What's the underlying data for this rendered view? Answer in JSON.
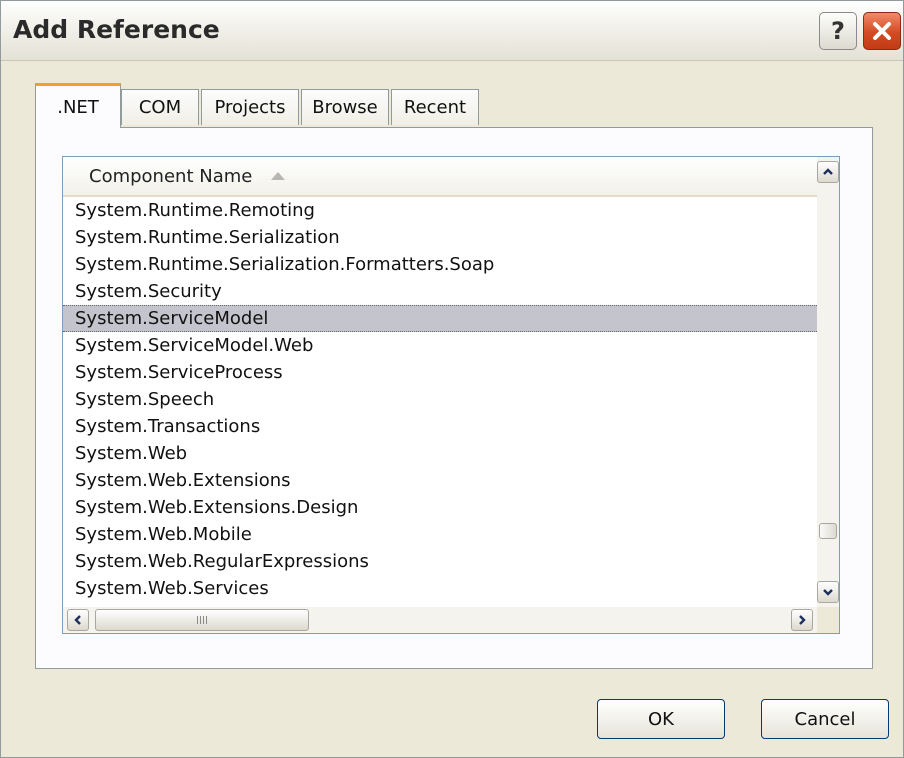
{
  "window": {
    "title": "Add Reference",
    "help_label": "?"
  },
  "tabs": [
    {
      "label": ".NET",
      "active": true
    },
    {
      "label": "COM",
      "active": false
    },
    {
      "label": "Projects",
      "active": false
    },
    {
      "label": "Browse",
      "active": false
    },
    {
      "label": "Recent",
      "active": false
    }
  ],
  "list": {
    "column_header": "Component Name",
    "sort": "ascending",
    "selected_item": "System.ServiceModel",
    "items": [
      "System.Runtime.Remoting",
      "System.Runtime.Serialization",
      "System.Runtime.Serialization.Formatters.Soap",
      "System.Security",
      "System.ServiceModel",
      "System.ServiceModel.Web",
      "System.ServiceProcess",
      "System.Speech",
      "System.Transactions",
      "System.Web",
      "System.Web.Extensions",
      "System.Web.Extensions.Design",
      "System.Web.Mobile",
      "System.Web.RegularExpressions",
      "System.Web.Services"
    ]
  },
  "buttons": {
    "ok": "OK",
    "cancel": "Cancel"
  },
  "colors": {
    "dialog_bg": "#ece9d8",
    "selection_bg": "#c4c4cc",
    "active_tab_accent": "#f3a028",
    "close_button": "#d44a22"
  }
}
